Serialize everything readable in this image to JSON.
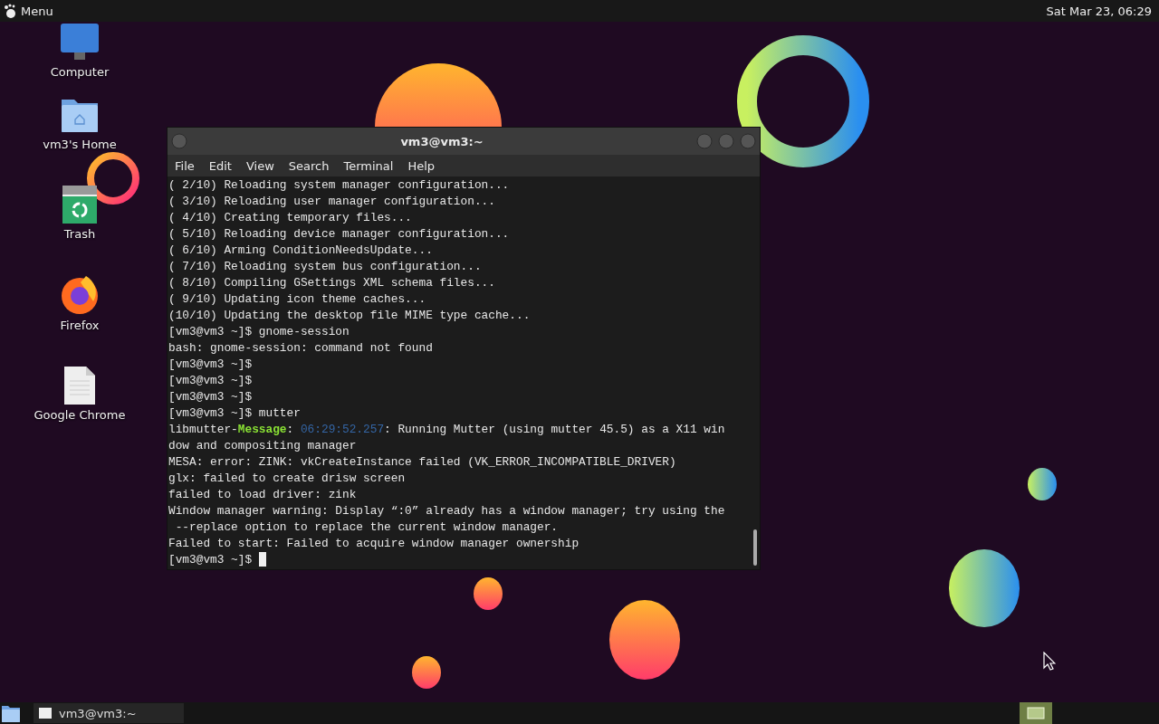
{
  "top_bar": {
    "menu_label": "Menu",
    "clock": "Sat Mar 23, 06:29"
  },
  "desktop_icons": [
    {
      "label": "Computer",
      "kind": "computer"
    },
    {
      "label": "vm3's Home",
      "kind": "home"
    },
    {
      "label": "Trash",
      "kind": "trash"
    },
    {
      "label": "Firefox",
      "kind": "firefox"
    },
    {
      "label": "Google Chrome",
      "kind": "file"
    }
  ],
  "terminal": {
    "title": "vm3@vm3:~",
    "menu": [
      "File",
      "Edit",
      "View",
      "Search",
      "Terminal",
      "Help"
    ],
    "lines": [
      {
        "text": "( 2/10) Reloading system manager configuration..."
      },
      {
        "text": "( 3/10) Reloading user manager configuration..."
      },
      {
        "text": "( 4/10) Creating temporary files..."
      },
      {
        "text": "( 5/10) Reloading device manager configuration..."
      },
      {
        "text": "( 6/10) Arming ConditionNeedsUpdate..."
      },
      {
        "text": "( 7/10) Reloading system bus configuration..."
      },
      {
        "text": "( 8/10) Compiling GSettings XML schema files..."
      },
      {
        "text": "( 9/10) Updating icon theme caches..."
      },
      {
        "text": "(10/10) Updating the desktop file MIME type cache..."
      },
      {
        "text": "[vm3@vm3 ~]$ gnome-session"
      },
      {
        "text": "bash: gnome-session: command not found"
      },
      {
        "text": "[vm3@vm3 ~]$"
      },
      {
        "text": "[vm3@vm3 ~]$"
      },
      {
        "text": "[vm3@vm3 ~]$"
      },
      {
        "text": "[vm3@vm3 ~]$ mutter"
      },
      {
        "parts": [
          {
            "text": "libmutter-",
            "kind": "plain"
          },
          {
            "text": "Message",
            "kind": "level"
          },
          {
            "text": ": ",
            "kind": "plain"
          },
          {
            "text": "06:29:52.257",
            "kind": "time"
          },
          {
            "text": ": Running Mutter (using mutter 45.5) as a X11 win",
            "kind": "plain"
          }
        ]
      },
      {
        "text": "dow and compositing manager"
      },
      {
        "text": "MESA: error: ZINK: vkCreateInstance failed (VK_ERROR_INCOMPATIBLE_DRIVER)"
      },
      {
        "text": "glx: failed to create drisw screen"
      },
      {
        "text": "failed to load driver: zink"
      },
      {
        "text": "Window manager warning: Display “:0” already has a window manager; try using the"
      },
      {
        "text": " --replace option to replace the current window manager."
      },
      {
        "text": "Failed to start: Failed to acquire window manager ownership"
      },
      {
        "text": "[vm3@vm3 ~]$ ",
        "cursor": true
      }
    ]
  },
  "taskbar": {
    "tasks": [
      {
        "label": "vm3@vm3:~",
        "selected": false
      }
    ]
  }
}
